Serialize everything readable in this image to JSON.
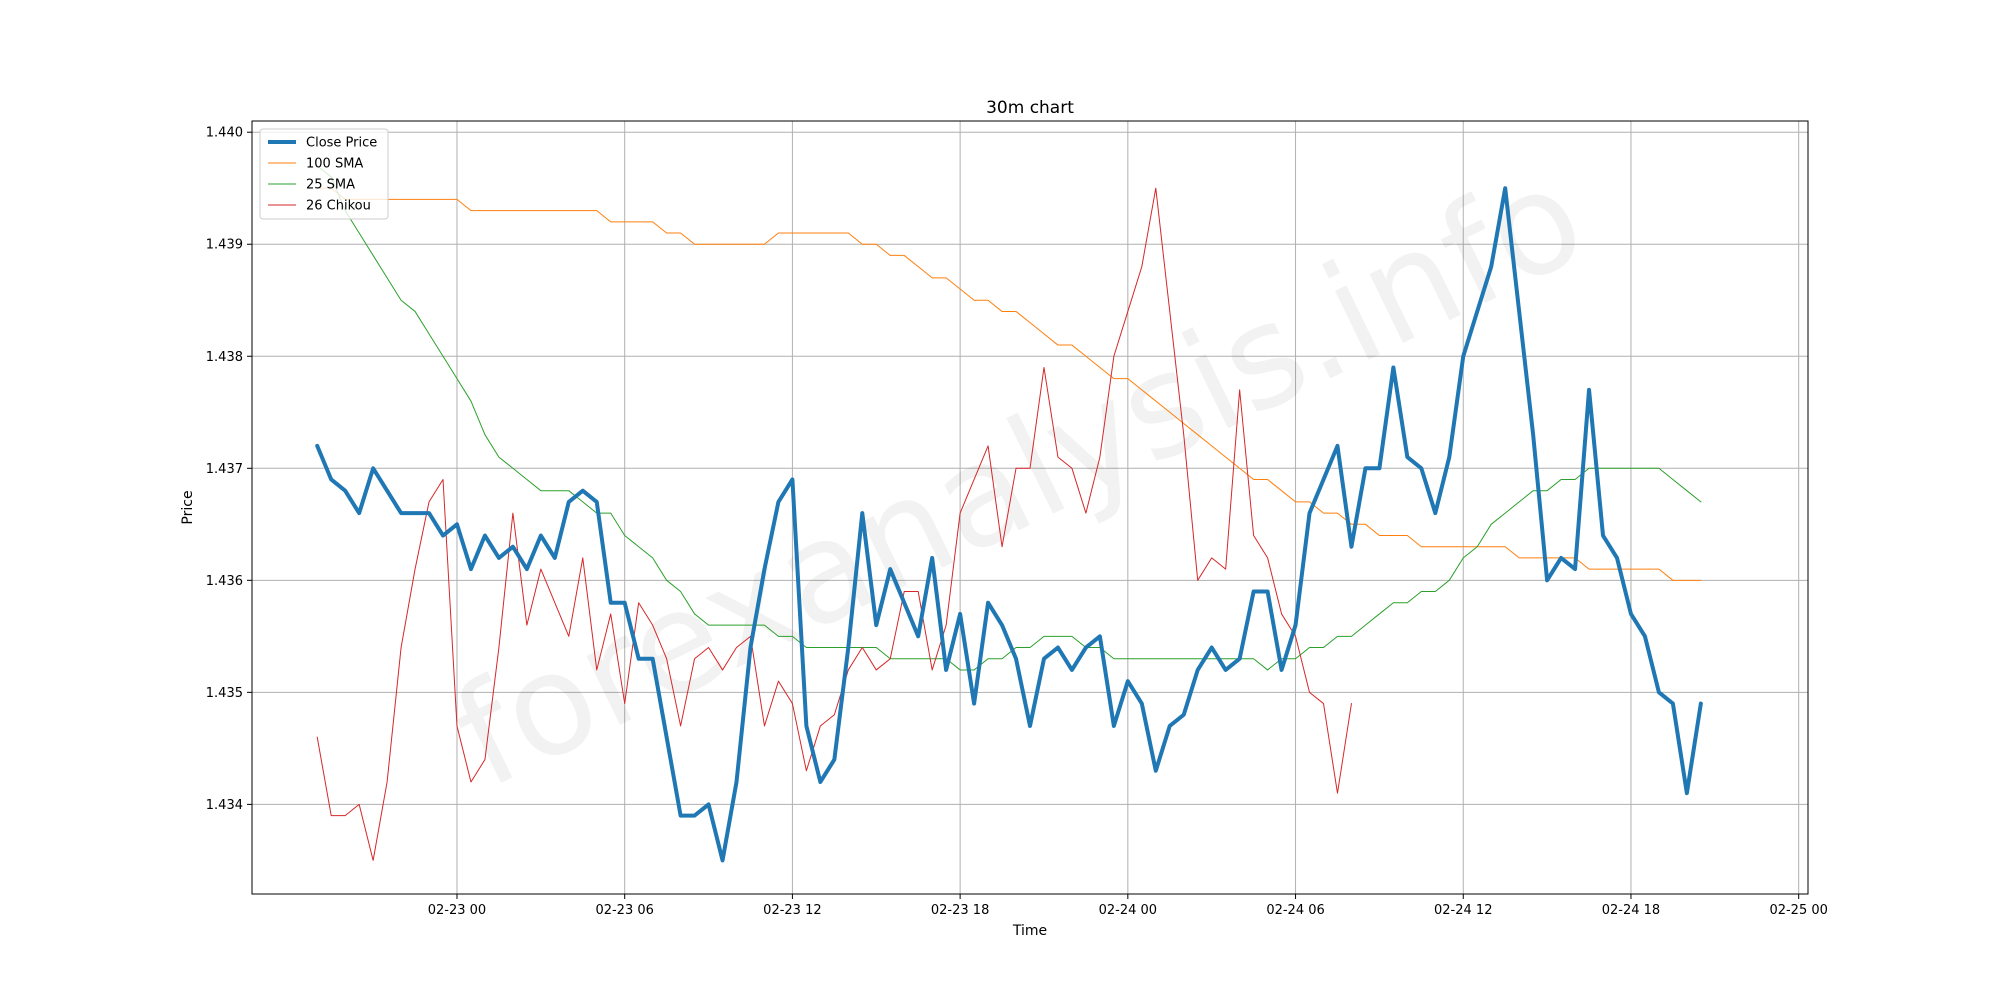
{
  "watermark": "forexanalysis.info",
  "chart_data": {
    "type": "line",
    "title": "30m chart",
    "xlabel": "Time",
    "ylabel": "Price",
    "x_unit": "datetime",
    "x_start": "2023-02-22 19:00",
    "x_step_minutes": 30,
    "xlim": [
      "2023-02-22 16:40",
      "2023-02-25 00:20"
    ],
    "ylim": [
      1.4332,
      1.4401
    ],
    "x_ticks": [
      {
        "t": "2023-02-23 00:00",
        "label": "02-23 00"
      },
      {
        "t": "2023-02-23 06:00",
        "label": "02-23 06"
      },
      {
        "t": "2023-02-23 12:00",
        "label": "02-23 12"
      },
      {
        "t": "2023-02-23 18:00",
        "label": "02-23 18"
      },
      {
        "t": "2023-02-24 00:00",
        "label": "02-24 00"
      },
      {
        "t": "2023-02-24 06:00",
        "label": "02-24 06"
      },
      {
        "t": "2023-02-24 12:00",
        "label": "02-24 12"
      },
      {
        "t": "2023-02-24 18:00",
        "label": "02-24 18"
      },
      {
        "t": "2023-02-25 00:00",
        "label": "02-25 00"
      }
    ],
    "y_ticks": [
      {
        "v": 1.434,
        "label": "1.434"
      },
      {
        "v": 1.435,
        "label": "1.435"
      },
      {
        "v": 1.436,
        "label": "1.436"
      },
      {
        "v": 1.437,
        "label": "1.437"
      },
      {
        "v": 1.438,
        "label": "1.438"
      },
      {
        "v": 1.439,
        "label": "1.439"
      },
      {
        "v": 1.44,
        "label": "1.440"
      }
    ],
    "grid": true,
    "legend_position": "top-left",
    "series": [
      {
        "name": "Close Price",
        "color": "#1f77b4",
        "values": [
          1.4372,
          1.4369,
          1.4368,
          1.4366,
          1.437,
          1.4368,
          1.4366,
          1.4366,
          1.4366,
          1.4364,
          1.4365,
          1.4361,
          1.4364,
          1.4362,
          1.4363,
          1.4361,
          1.4364,
          1.4362,
          1.4367,
          1.4368,
          1.4367,
          1.4358,
          1.4358,
          1.4353,
          1.4353,
          1.4346,
          1.4339,
          1.4339,
          1.434,
          1.4335,
          1.4342,
          1.4354,
          1.4361,
          1.4367,
          1.4369,
          1.4347,
          1.4342,
          1.4344,
          1.4354,
          1.4366,
          1.4356,
          1.4361,
          1.4358,
          1.4355,
          1.4362,
          1.4352,
          1.4357,
          1.4349,
          1.4358,
          1.4356,
          1.4353,
          1.4347,
          1.4353,
          1.4354,
          1.4352,
          1.4354,
          1.4355,
          1.4347,
          1.4351,
          1.4349,
          1.4343,
          1.4347,
          1.4348,
          1.4352,
          1.4354,
          1.4352,
          1.4353,
          1.4359,
          1.4359,
          1.4352,
          1.4356,
          1.4366,
          1.4369,
          1.4372,
          1.4363,
          1.437,
          1.437,
          1.4379,
          1.4371,
          1.437,
          1.4366,
          1.4371,
          1.438,
          1.4384,
          1.4388,
          1.4395,
          1.4384,
          1.4373,
          1.436,
          1.4362,
          1.4361,
          1.4377,
          1.4364,
          1.4362,
          1.4357,
          1.4355,
          1.435,
          1.4349,
          1.4341,
          1.4349
        ]
      },
      {
        "name": "100 SMA",
        "color": "#ff7f0e",
        "values": [
          1.4395,
          1.4395,
          1.4394,
          1.4394,
          1.4394,
          1.4394,
          1.4394,
          1.4394,
          1.4394,
          1.4394,
          1.4394,
          1.4393,
          1.4393,
          1.4393,
          1.4393,
          1.4393,
          1.4393,
          1.4393,
          1.4393,
          1.4393,
          1.4393,
          1.4392,
          1.4392,
          1.4392,
          1.4392,
          1.4391,
          1.4391,
          1.439,
          1.439,
          1.439,
          1.439,
          1.439,
          1.439,
          1.4391,
          1.4391,
          1.4391,
          1.4391,
          1.4391,
          1.4391,
          1.439,
          1.439,
          1.4389,
          1.4389,
          1.4388,
          1.4387,
          1.4387,
          1.4386,
          1.4385,
          1.4385,
          1.4384,
          1.4384,
          1.4383,
          1.4382,
          1.4381,
          1.4381,
          1.438,
          1.4379,
          1.4378,
          1.4378,
          1.4377,
          1.4376,
          1.4375,
          1.4374,
          1.4373,
          1.4372,
          1.4371,
          1.437,
          1.4369,
          1.4369,
          1.4368,
          1.4367,
          1.4367,
          1.4366,
          1.4366,
          1.4365,
          1.4365,
          1.4364,
          1.4364,
          1.4364,
          1.4363,
          1.4363,
          1.4363,
          1.4363,
          1.4363,
          1.4363,
          1.4363,
          1.4362,
          1.4362,
          1.4362,
          1.4362,
          1.4362,
          1.4361,
          1.4361,
          1.4361,
          1.4361,
          1.4361,
          1.4361,
          1.436,
          1.436,
          1.436
        ]
      },
      {
        "name": "25 SMA",
        "color": "#2ca02c",
        "values": [
          1.4397,
          1.4396,
          1.4393,
          1.4391,
          1.4389,
          1.4387,
          1.4385,
          1.4384,
          1.4382,
          1.438,
          1.4378,
          1.4376,
          1.4373,
          1.4371,
          1.437,
          1.4369,
          1.4368,
          1.4368,
          1.4368,
          1.4367,
          1.4366,
          1.4366,
          1.4364,
          1.4363,
          1.4362,
          1.436,
          1.4359,
          1.4357,
          1.4356,
          1.4356,
          1.4356,
          1.4356,
          1.4356,
          1.4355,
          1.4355,
          1.4354,
          1.4354,
          1.4354,
          1.4354,
          1.4354,
          1.4354,
          1.4353,
          1.4353,
          1.4353,
          1.4353,
          1.4353,
          1.4352,
          1.4352,
          1.4353,
          1.4353,
          1.4354,
          1.4354,
          1.4355,
          1.4355,
          1.4355,
          1.4354,
          1.4354,
          1.4353,
          1.4353,
          1.4353,
          1.4353,
          1.4353,
          1.4353,
          1.4353,
          1.4353,
          1.4353,
          1.4353,
          1.4353,
          1.4352,
          1.4353,
          1.4353,
          1.4354,
          1.4354,
          1.4355,
          1.4355,
          1.4356,
          1.4357,
          1.4358,
          1.4358,
          1.4359,
          1.4359,
          1.436,
          1.4362,
          1.4363,
          1.4365,
          1.4366,
          1.4367,
          1.4368,
          1.4368,
          1.4369,
          1.4369,
          1.437,
          1.437,
          1.437,
          1.437,
          1.437,
          1.437,
          1.4369,
          1.4368,
          1.4367
        ]
      },
      {
        "name": "26 Chikou",
        "color": "#d62728",
        "values": [
          1.4346,
          1.4339,
          1.4339,
          1.434,
          1.4335,
          1.4342,
          1.4354,
          1.4361,
          1.4367,
          1.4369,
          1.4347,
          1.4342,
          1.4344,
          1.4354,
          1.4366,
          1.4356,
          1.4361,
          1.4358,
          1.4355,
          1.4362,
          1.4352,
          1.4357,
          1.4349,
          1.4358,
          1.4356,
          1.4353,
          1.4347,
          1.4353,
          1.4354,
          1.4352,
          1.4354,
          1.4355,
          1.4347,
          1.4351,
          1.4349,
          1.4343,
          1.4347,
          1.4348,
          1.4352,
          1.4354,
          1.4352,
          1.4353,
          1.4359,
          1.4359,
          1.4352,
          1.4356,
          1.4366,
          1.4369,
          1.4372,
          1.4363,
          1.437,
          1.437,
          1.4379,
          1.4371,
          1.437,
          1.4366,
          1.4371,
          1.438,
          1.4384,
          1.4388,
          1.4395,
          1.4384,
          1.4373,
          1.436,
          1.4362,
          1.4361,
          1.4377,
          1.4364,
          1.4362,
          1.4357,
          1.4355,
          1.435,
          1.4349,
          1.4341,
          1.4349
        ]
      }
    ]
  }
}
